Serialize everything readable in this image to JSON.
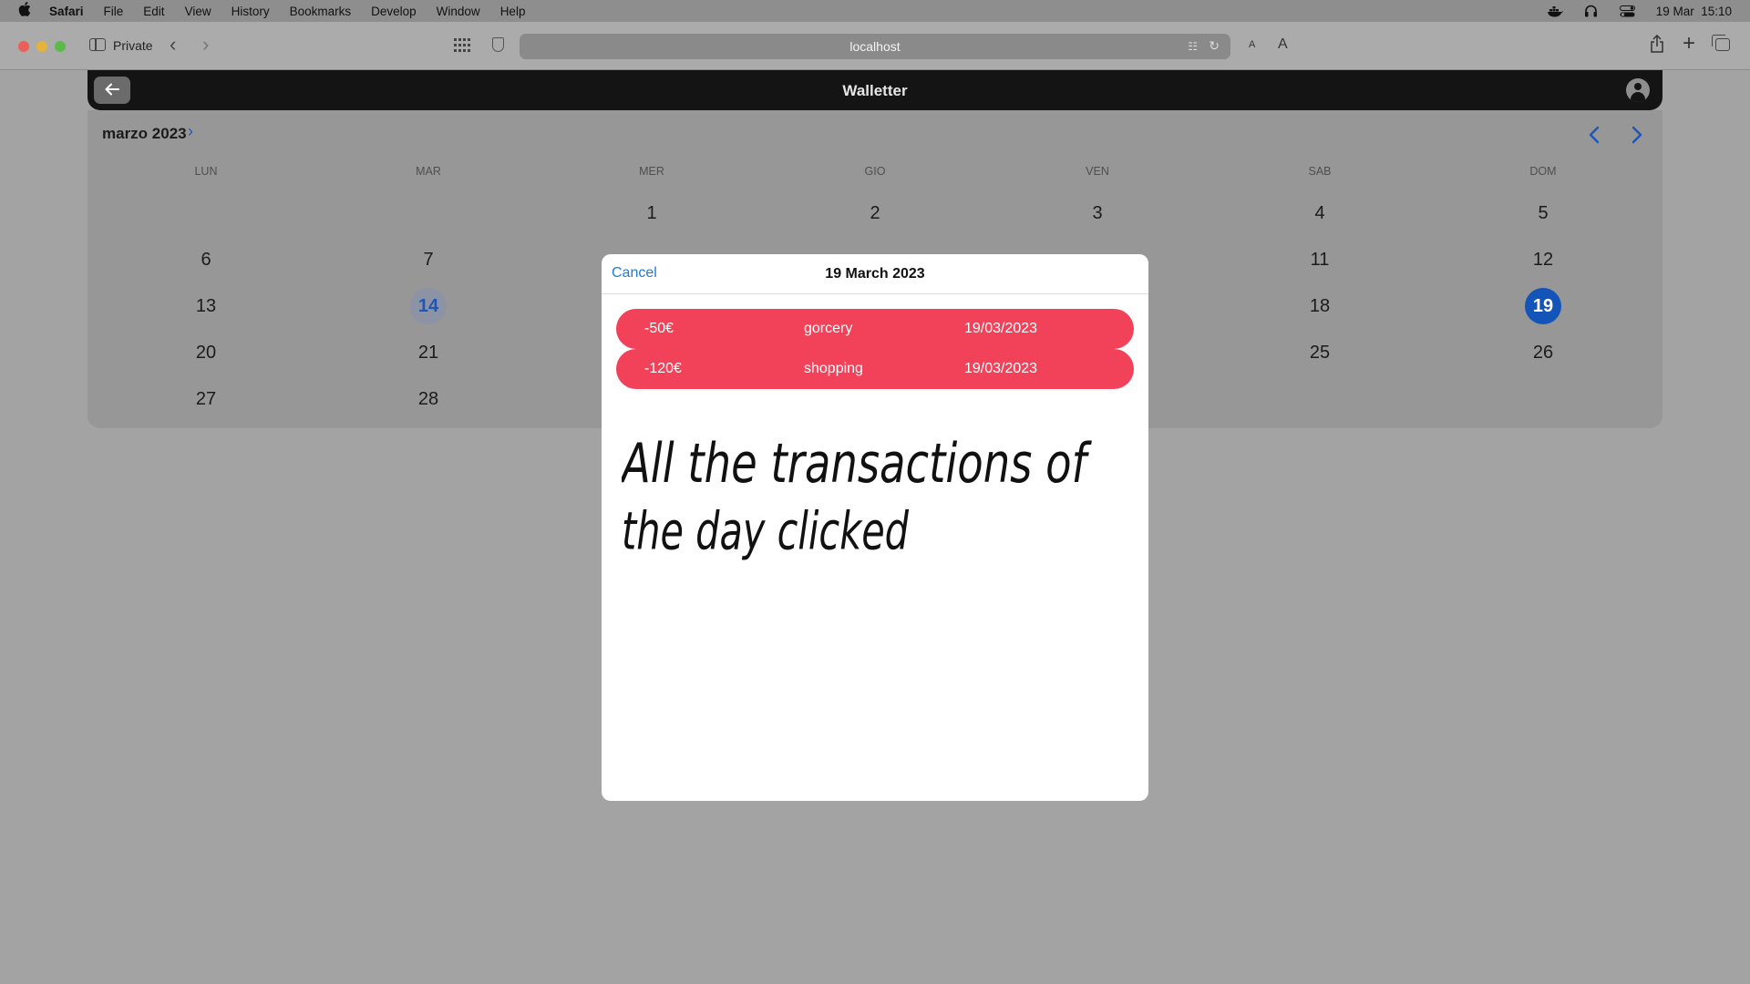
{
  "menubar": {
    "items": [
      "Safari",
      "File",
      "Edit",
      "View",
      "History",
      "Bookmarks",
      "Develop",
      "Window",
      "Help"
    ],
    "datetime": "19 Mar  15:10"
  },
  "browser": {
    "private_label": "Private",
    "url": "localhost",
    "font_small": "A",
    "font_large": "A"
  },
  "app": {
    "title": "Walletter"
  },
  "calendar": {
    "month_label": "marzo 2023",
    "weekdays": [
      "LUN",
      "MAR",
      "MER",
      "GIO",
      "VEN",
      "SAB",
      "DOM"
    ],
    "days": {
      "d1": "1",
      "d2": "2",
      "d3": "3",
      "d4": "4",
      "d5": "5",
      "d6": "6",
      "d7": "7",
      "d11": "11",
      "d12": "12",
      "d13": "13",
      "d14": "14",
      "d18": "18",
      "d19": "19",
      "d20": "20",
      "d21": "21",
      "d25": "25",
      "d26": "26",
      "d27": "27",
      "d28": "28"
    },
    "today": "14",
    "selected": "19"
  },
  "modal": {
    "cancel_label": "Cancel",
    "title": "19 March 2023",
    "transactions": [
      {
        "amount": "-50€",
        "category": "gorcery",
        "date": "19/03/2023"
      },
      {
        "amount": "-120€",
        "category": "shopping",
        "date": "19/03/2023"
      }
    ],
    "handwritten_note": "All the transactions of the day clicked"
  },
  "colors": {
    "accent": "#1254b8",
    "expense": "#f2425a",
    "link": "#1e7bd6"
  }
}
